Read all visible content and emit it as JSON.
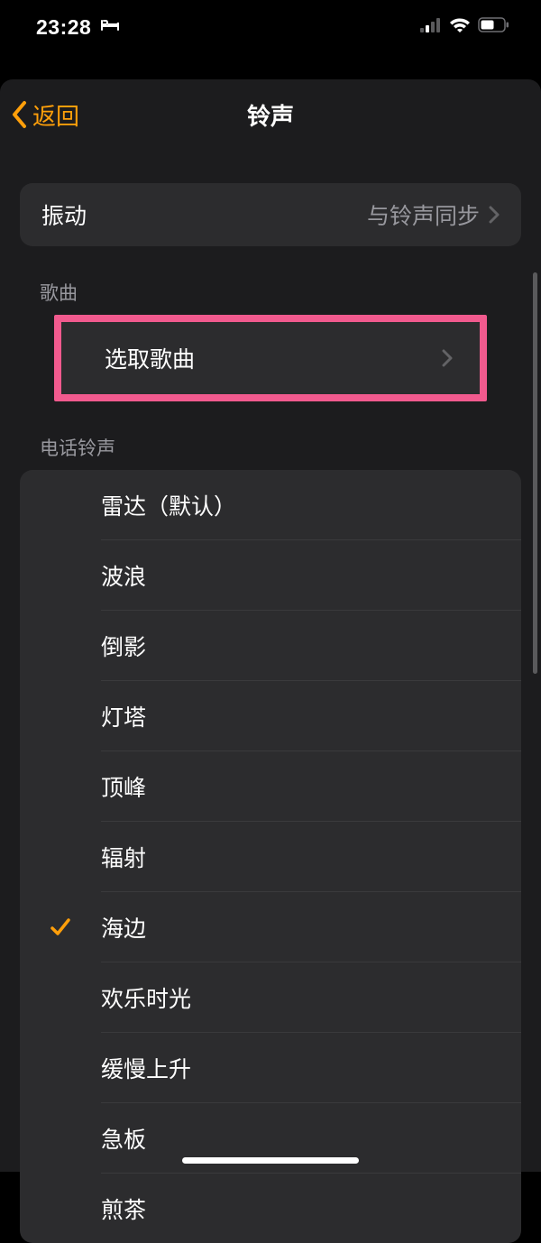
{
  "status": {
    "time": "23:28"
  },
  "nav": {
    "back": "返回",
    "title": "铃声"
  },
  "vibration": {
    "label": "振动",
    "value": "与铃声同步"
  },
  "songSection": {
    "title": "歌曲",
    "pick": "选取歌曲"
  },
  "ringtoneSection": {
    "title": "电话铃声",
    "selectedIndex": 6,
    "items": [
      "雷达（默认）",
      "波浪",
      "倒影",
      "灯塔",
      "顶峰",
      "辐射",
      "海边",
      "欢乐时光",
      "缓慢上升",
      "急板",
      "煎茶"
    ]
  }
}
